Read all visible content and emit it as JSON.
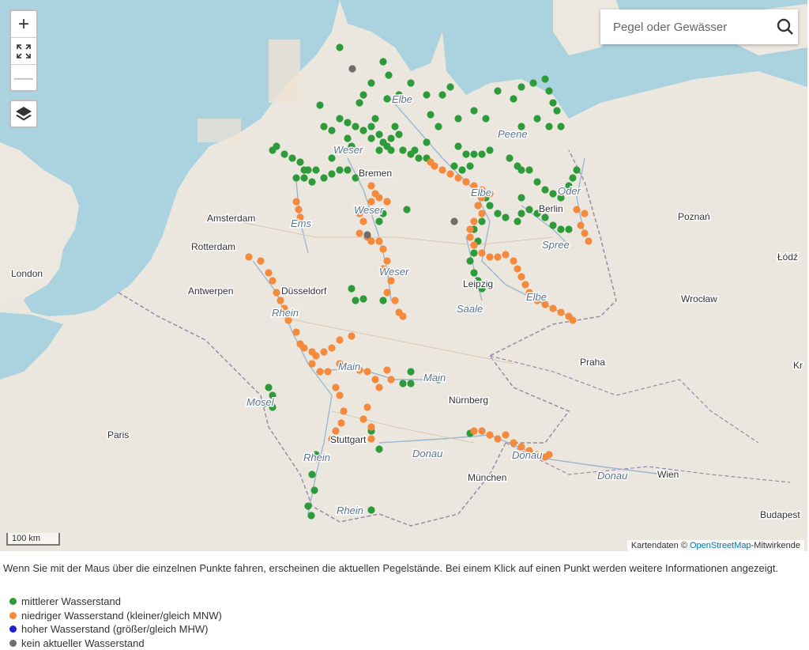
{
  "search": {
    "placeholder": "Pegel oder Gewässer"
  },
  "zoom": {
    "in": "+",
    "out": "—"
  },
  "scale_label": "100 km",
  "attribution": {
    "prefix": "Kartendaten © ",
    "link": "OpenStreetMap",
    "suffix": "-Mitwirkende"
  },
  "cities": {
    "london": "London",
    "amsterdam": "Amsterdam",
    "rotterdam": "Rotterdam",
    "antwerpen": "Antwerpen",
    "paris": "Paris",
    "bremen": "Bremen",
    "berlin": "Berlin",
    "poznan": "Poznań",
    "lodz": "Łódź",
    "wroclaw": "Wrocław",
    "praha": "Praha",
    "leipzig": "Leipzig",
    "duesseldorf": "Düsseldorf",
    "nuernberg": "Nürnberg",
    "stuttgart": "Stuttgart",
    "muenchen": "München",
    "wien": "Wien",
    "budapest": "Budapest",
    "krakow": "Kr"
  },
  "rivers": {
    "elbe1": "Elbe",
    "peene": "Peene",
    "weser1": "Weser",
    "oder": "Oder",
    "weser2": "Weser",
    "ems": "Ems",
    "elbe2": "Elbe",
    "spree": "Spree",
    "weser3": "Weser",
    "saale": "Saale",
    "elbe3": "Elbe",
    "rhein1": "Rhein",
    "main1": "Main",
    "main2": "Main",
    "mosel": "Mosel",
    "donau1": "Donau",
    "donau2": "Donau",
    "donau3": "Donau",
    "rhein2": "Rhein",
    "rhein3": "Rhein"
  },
  "description": "Wenn Sie mit der Maus über die einzelnen Punkte fahren, erscheinen die aktuellen Pegelstände. Bei einem Klick auf einen Punkt werden weitere Informationen angezeigt.",
  "legend": [
    {
      "label": "mittlerer Wasserstand",
      "color": "#2e9b3a"
    },
    {
      "label": "niedriger Wasserstand (kleiner/gleich MNW)",
      "color": "#f5893c"
    },
    {
      "label": "hoher Wasserstand (größer/gleich MHW)",
      "color": "#1f1fcf"
    },
    {
      "label": "kein aktueller Wasserstand",
      "color": "#6e6e6e"
    }
  ],
  "colors": {
    "green": "#2e9b3a",
    "orange": "#f5893c",
    "grey": "#6e6e6e",
    "sea": "#aad3df",
    "land": "#ece8df"
  }
}
